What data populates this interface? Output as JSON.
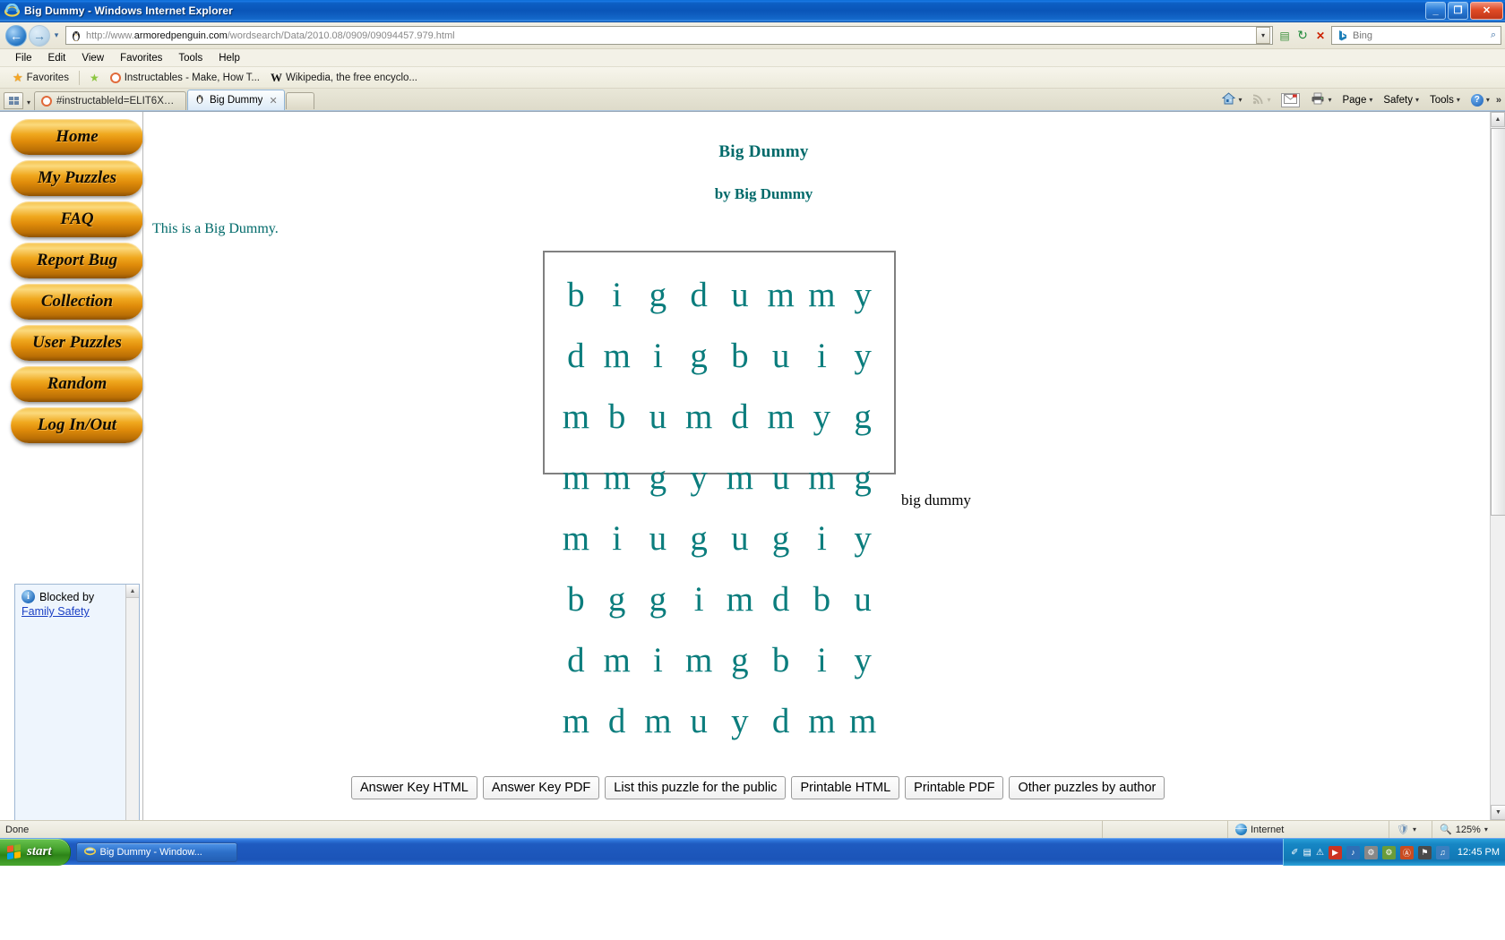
{
  "window": {
    "title": "Big Dummy - Windows Internet Explorer",
    "minimize_label": "_",
    "maximize_label": "❐",
    "close_label": "✕"
  },
  "address_bar": {
    "url_prefix": "http://www.",
    "url_domain": "armoredpenguin.com",
    "url_suffix": "/wordsearch/Data/2010.08/0909/09094457.979.html",
    "url_full": "http://www.armoredpenguin.com/wordsearch/Data/2010.08/0909/09094457.979.html",
    "dropdown_caret": "▾",
    "back_glyph": "←",
    "forward_glyph": "→",
    "compat_glyph": "▤",
    "refresh_glyph": "↻",
    "stop_glyph": "✕",
    "search_placeholder": "Bing",
    "search_value": "",
    "search_go_glyph": "⌕"
  },
  "menu": {
    "items": [
      "File",
      "Edit",
      "View",
      "Favorites",
      "Tools",
      "Help"
    ]
  },
  "favorites_bar": {
    "favorites_label": "Favorites",
    "links": [
      {
        "label": "Instructables - Make, How T...",
        "icon": "instructables-icon"
      },
      {
        "label": "Wikipedia, the free encyclo...",
        "icon": "wikipedia-icon"
      }
    ]
  },
  "tabs": [
    {
      "label": "#instructableId=ELIT6XVGCJ...",
      "active": false,
      "icon": "instructables-icon"
    },
    {
      "label": "Big Dummy",
      "active": true,
      "icon": "penguin-icon",
      "close_glyph": "✕"
    }
  ],
  "command_bar": {
    "home_glyph": "⌂",
    "feeds_glyph": "◉",
    "mail_glyph": "✉",
    "print_glyph": "⎙",
    "page_label": "Page",
    "safety_label": "Safety",
    "tools_label": "Tools",
    "help_glyph": "?",
    "overflow_glyph": "»",
    "caret": "▾"
  },
  "sidebar": {
    "buttons": [
      {
        "label": "Home"
      },
      {
        "label": "My Puzzles"
      },
      {
        "label": "FAQ"
      },
      {
        "label": "Report Bug"
      },
      {
        "label": "Collection"
      },
      {
        "label": "User Puzzles"
      },
      {
        "label": "Random"
      },
      {
        "label": "Log In/Out"
      }
    ],
    "blocked_panel": {
      "info_glyph": "i",
      "text": "Blocked by",
      "link": "Family Safety",
      "scroll_up_glyph": "▲"
    }
  },
  "puzzle": {
    "title": "Big Dummy",
    "author_line": "by Big Dummy",
    "description": "This is a Big Dummy.",
    "grid": [
      [
        "b",
        "i",
        "g",
        "d",
        "u",
        "m",
        "m",
        "y"
      ],
      [
        "d",
        "m",
        "i",
        "g",
        "b",
        "u",
        "i",
        "y"
      ],
      [
        "m",
        "b",
        "u",
        "m",
        "d",
        "m",
        "y",
        "g"
      ],
      [
        "m",
        "m",
        "g",
        "y",
        "m",
        "u",
        "m",
        "g"
      ],
      [
        "m",
        "i",
        "u",
        "g",
        "u",
        "g",
        "i",
        "y"
      ],
      [
        "b",
        "g",
        "g",
        "i",
        "m",
        "d",
        "b",
        "u"
      ],
      [
        "d",
        "m",
        "i",
        "m",
        "g",
        "b",
        "i",
        "y"
      ],
      [
        "m",
        "d",
        "m",
        "u",
        "y",
        "d",
        "m",
        "m"
      ]
    ],
    "word_list": [
      "big dummy"
    ],
    "word_list_text": "big dummy",
    "buttons": [
      "Answer Key HTML",
      "Answer Key PDF",
      "List this puzzle for the public",
      "Printable HTML",
      "Printable PDF",
      "Other puzzles by author"
    ],
    "colors": {
      "letters": "#0b7d7d",
      "heading": "#006a6a",
      "grid_border": "#808080"
    }
  },
  "page_scrollbar": {
    "up_glyph": "▲",
    "down_glyph": "▼"
  },
  "status_bar": {
    "message": "Done",
    "zone": "Internet",
    "zone_icon": "globe-icon",
    "protected_icon": "shield-icon",
    "zoom": "125%",
    "zoom_caret": "▾"
  },
  "taskbar": {
    "start_label": "start",
    "tasks": [
      {
        "label": "Big Dummy - Window...",
        "icon": "ie-icon"
      }
    ],
    "tray_glyphs": [
      "✐",
      "▤",
      "⚠"
    ],
    "tray_icons": [
      "▶",
      "♪",
      "⚙",
      "⚙",
      "Ⓐ",
      "⚑",
      "♫"
    ],
    "clock": "12:45 PM"
  }
}
